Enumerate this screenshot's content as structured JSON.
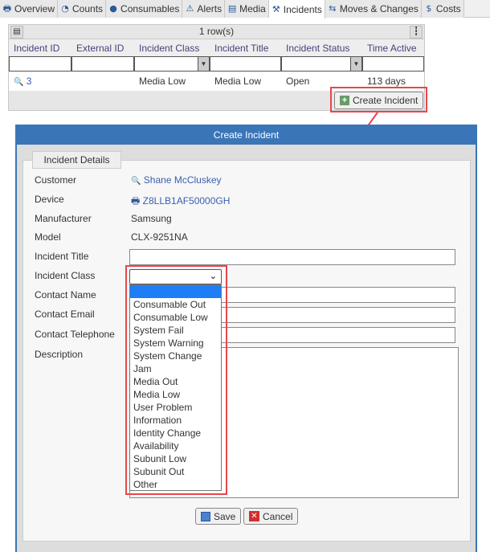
{
  "tabs": [
    {
      "label": "Overview",
      "icon": "printer-icon"
    },
    {
      "label": "Counts",
      "icon": "gauge-icon"
    },
    {
      "label": "Consumables",
      "icon": "drop-icon"
    },
    {
      "label": "Alerts",
      "icon": "warning-icon"
    },
    {
      "label": "Media",
      "icon": "list-icon"
    },
    {
      "label": "Incidents",
      "icon": "tools-icon",
      "active": true
    },
    {
      "label": "Moves & Changes",
      "icon": "arrows-icon"
    },
    {
      "label": "Costs",
      "icon": "coin-icon"
    }
  ],
  "grid": {
    "row_count": "1 row(s)",
    "columns": [
      "Incident ID",
      "External ID",
      "Incident Class",
      "Incident Title",
      "Incident Status",
      "Time Active"
    ],
    "rows": [
      {
        "id": "3",
        "external_id": "",
        "class": "Media Low",
        "title": "Media Low",
        "status": "Open",
        "time_active": "113 days"
      }
    ],
    "create_button": "Create Incident"
  },
  "dialog": {
    "title": "Create Incident",
    "section": "Incident Details",
    "fields": {
      "customer_label": "Customer",
      "customer": "Shane McCluskey",
      "device_label": "Device",
      "device": "Z8LLB1AF50000GH",
      "manufacturer_label": "Manufacturer",
      "manufacturer": "Samsung",
      "model_label": "Model",
      "model": "CLX-9251NA",
      "title_label": "Incident Title",
      "class_label": "Incident Class",
      "contact_name_label": "Contact Name",
      "contact_email_label": "Contact Email",
      "contact_phone_label": "Contact Telephone",
      "description_label": "Description"
    },
    "class_options": [
      "",
      "Consumable Out",
      "Consumable Low",
      "System Fail",
      "System Warning",
      "System Change",
      "Jam",
      "Media Out",
      "Media Low",
      "User Problem",
      "Information",
      "Identity Change",
      "Availability",
      "Subunit Low",
      "Subunit Out",
      "Other"
    ],
    "save": "Save",
    "cancel": "Cancel"
  },
  "colors": {
    "accent": "#3a75b8",
    "highlight": "#e8464b",
    "selected_option": "#1e7ef5"
  }
}
